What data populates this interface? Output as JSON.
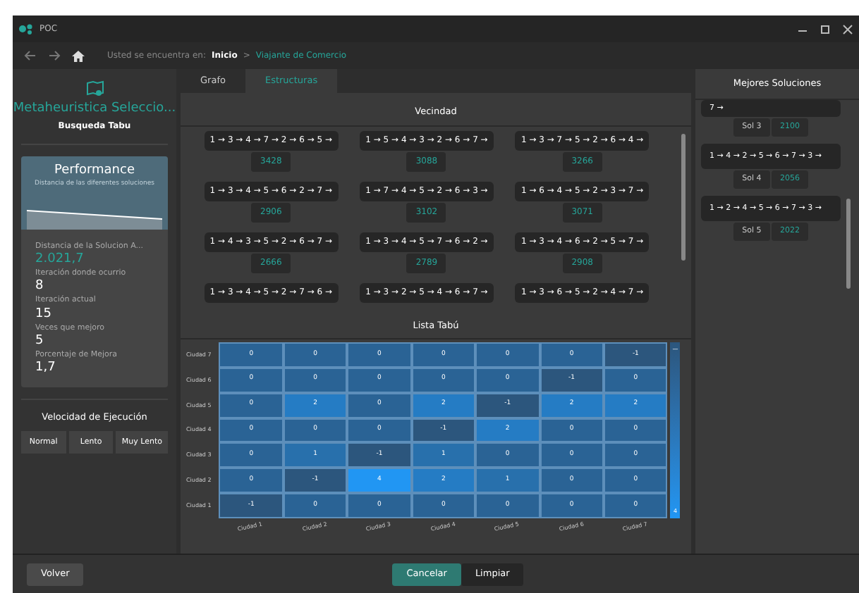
{
  "window": {
    "title": "POC"
  },
  "breadcrumb": {
    "prefix": "Usted se encuentra en:",
    "items": [
      {
        "label": "Inicio",
        "selected": false
      },
      {
        "label": "Viajante de Comercio",
        "selected": true
      }
    ],
    "separator": ">"
  },
  "sidebar": {
    "title": "Metaheuristica Seleccio...",
    "subtitle": "Busqueda Tabu",
    "performance": {
      "title": "Performance",
      "subtitle": "Distancia de las diferentes soluciones",
      "stats": [
        {
          "label": "Distancia de la Solucion A...",
          "value": "2.021,7",
          "highlight": true
        },
        {
          "label": "Iteración donde ocurrio",
          "value": "8",
          "highlight": false
        },
        {
          "label": "Iteración actual",
          "value": "15",
          "highlight": false
        },
        {
          "label": "Veces que mejoro",
          "value": "5",
          "highlight": false
        },
        {
          "label": "Porcentaje de Mejora",
          "value": "1,7",
          "highlight": false
        }
      ]
    },
    "speed": {
      "title": "Velocidad de Ejecución",
      "buttons": [
        "Normal",
        "Lento",
        "Muy Lento"
      ]
    }
  },
  "tabs": [
    {
      "label": "Grafo",
      "selected": false
    },
    {
      "label": "Estructuras",
      "selected": true
    }
  ],
  "neighborhood": {
    "title": "Vecindad",
    "items": [
      {
        "route": "1 → 3 → 4 → 7 → 2 → 6 → 5 →",
        "cost": "3428"
      },
      {
        "route": "1 → 5 → 4 → 3 → 2 → 6 → 7 →",
        "cost": "3088"
      },
      {
        "route": "1 → 3 → 7 → 5 → 2 → 6 → 4 →",
        "cost": "3266"
      },
      {
        "route": "1 → 3 → 4 → 5 → 6 → 2 → 7 →",
        "cost": "2906"
      },
      {
        "route": "1 → 7 → 4 → 5 → 2 → 6 → 3 →",
        "cost": "3102"
      },
      {
        "route": "1 → 6 → 4 → 5 → 2 → 3 → 7 →",
        "cost": "3071"
      },
      {
        "route": "1 → 4 → 3 → 5 → 2 → 6 → 7 →",
        "cost": "2666"
      },
      {
        "route": "1 → 3 → 4 → 5 → 7 → 6 → 2 →",
        "cost": "2789"
      },
      {
        "route": "1 → 3 → 4 → 6 → 2 → 5 → 7 →",
        "cost": "2908"
      },
      {
        "route": "1 → 3 → 4 → 5 → 2 → 7 → 6 →"
      },
      {
        "route": "1 → 3 → 2 → 5 → 4 → 6 → 7 →"
      },
      {
        "route": "1 → 3 → 6 → 5 → 2 → 4 → 7 →"
      }
    ]
  },
  "tabu_list": {
    "title": "Lista Tabú",
    "columns": [
      "Ciudad 1",
      "Ciudad 2",
      "Ciudad 3",
      "Ciudad 4",
      "Ciudad 5",
      "Ciudad 6",
      "Ciudad 7"
    ],
    "rows": [
      {
        "label": "Ciudad 7",
        "values": [
          "0",
          "0",
          "0",
          "0",
          "0",
          "0",
          "-1"
        ]
      },
      {
        "label": "Ciudad 6",
        "values": [
          "0",
          "0",
          "0",
          "0",
          "0",
          "-1",
          "0"
        ]
      },
      {
        "label": "Ciudad 5",
        "values": [
          "0",
          "2",
          "0",
          "2",
          "-1",
          "2",
          "2"
        ]
      },
      {
        "label": "Ciudad 4",
        "values": [
          "0",
          "0",
          "0",
          "-1",
          "2",
          "0",
          "0"
        ]
      },
      {
        "label": "Ciudad 3",
        "values": [
          "0",
          "1",
          "-1",
          "1",
          "0",
          "0",
          "0"
        ]
      },
      {
        "label": "Ciudad 2",
        "values": [
          "0",
          "-1",
          "4",
          "2",
          "1",
          "0",
          "0"
        ]
      },
      {
        "label": "Ciudad 1",
        "values": [
          "-1",
          "0",
          "0",
          "0",
          "0",
          "0",
          "0"
        ]
      }
    ],
    "scale_min": "—",
    "scale_max": "4"
  },
  "best_solutions": {
    "title": "Mejores Soluciones",
    "items": [
      {
        "route": "7 →",
        "name": "Sol 3",
        "cost": "2100"
      },
      {
        "route": "1 → 4 → 2 → 5 → 6 → 7 → 3 →",
        "name": "Sol 4",
        "cost": "2056"
      },
      {
        "route": "1 → 2 → 4 → 5 → 6 → 7 → 3 →",
        "name": "Sol 5",
        "cost": "2022"
      }
    ]
  },
  "footer": {
    "buttons": [
      {
        "label": "Volver",
        "kind": "secondary"
      },
      {
        "label": "Cancelar",
        "kind": "primary"
      },
      {
        "label": "Limpiar",
        "kind": "dark"
      }
    ]
  }
}
